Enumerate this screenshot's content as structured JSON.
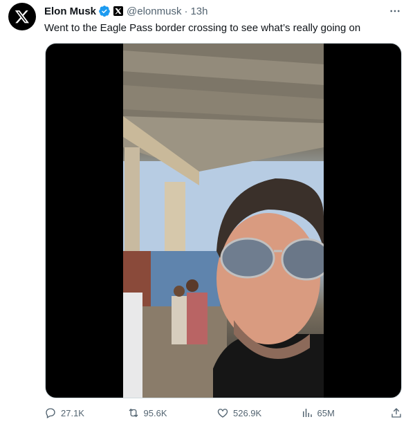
{
  "tweet": {
    "display_name": "Elon Musk",
    "handle": "@elonmusk",
    "separator": "·",
    "timestamp": "13h",
    "text": "Went to the Eagle Pass border crossing to see what’s really going on"
  },
  "actions": {
    "replies": "27.1K",
    "reposts": "95.6K",
    "likes": "526.9K",
    "views": "65M"
  },
  "colors": {
    "verified_badge": "#1d9bf0",
    "secondary_text": "#536471"
  },
  "icons": [
    "x-logo-icon",
    "verified-badge-icon",
    "x-affiliate-badge-icon",
    "more-icon",
    "reply-icon",
    "repost-icon",
    "like-icon",
    "views-icon",
    "share-icon"
  ]
}
